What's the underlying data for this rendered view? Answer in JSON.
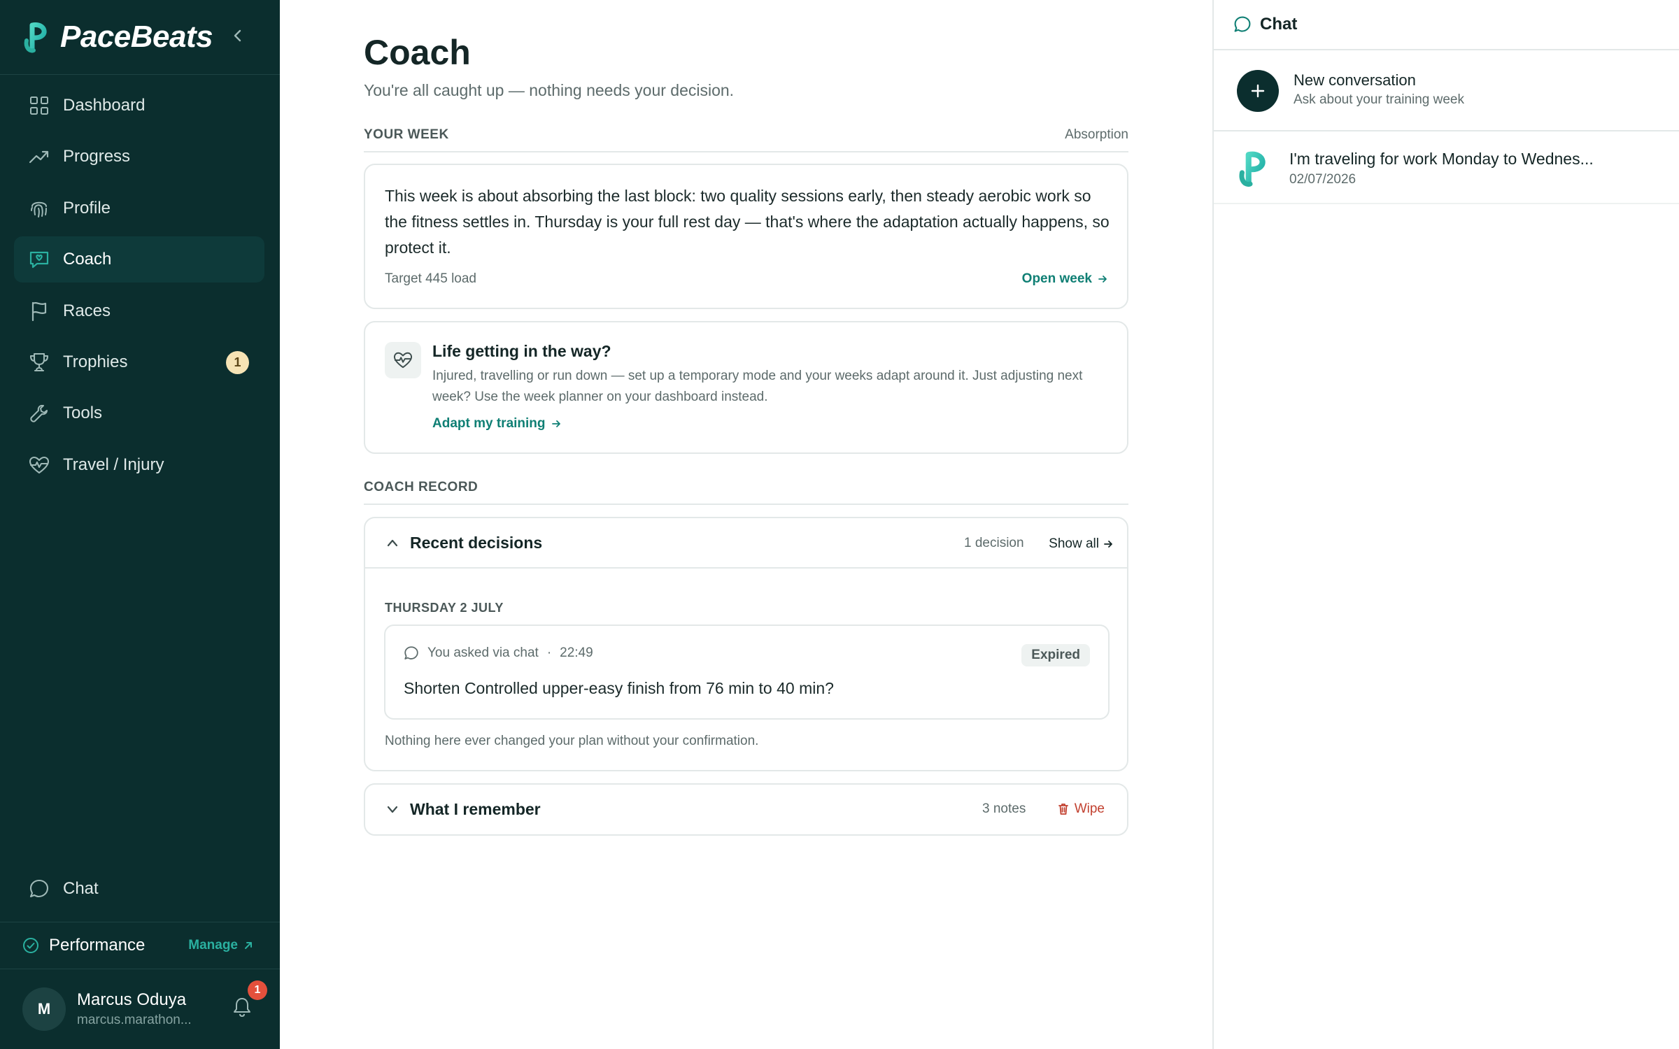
{
  "app": {
    "name": "PaceBeats"
  },
  "sidebar": {
    "items": [
      {
        "label": "Dashboard",
        "icon": "dashboard-icon"
      },
      {
        "label": "Progress",
        "icon": "trending-up-icon"
      },
      {
        "label": "Profile",
        "icon": "fingerprint-icon"
      },
      {
        "label": "Coach",
        "icon": "coach-message-icon",
        "active": true
      },
      {
        "label": "Races",
        "icon": "flag-icon"
      },
      {
        "label": "Trophies",
        "icon": "trophy-icon",
        "badge": "1"
      },
      {
        "label": "Tools",
        "icon": "wrench-icon"
      },
      {
        "label": "Travel / Injury",
        "icon": "heart-pulse-icon"
      }
    ],
    "chat_label": "Chat",
    "plan": {
      "label": "Performance",
      "manage_label": "Manage"
    },
    "user": {
      "initial": "M",
      "name": "Marcus Oduya",
      "email": "marcus.marathon...",
      "notification_count": "1"
    }
  },
  "main": {
    "title": "Coach",
    "subtitle": "You're all caught up — nothing needs your decision.",
    "your_week": {
      "label": "YOUR WEEK",
      "phase": "Absorption",
      "text": "This week is about absorbing the last block: two quality sessions early, then steady aerobic work so the fitness settles in. Thursday is your full rest day — that's where the adaptation actually happens, so protect it.",
      "target": "Target 445 load",
      "open_link": "Open week"
    },
    "life": {
      "title": "Life getting in the way?",
      "text": "Injured, travelling or run down — set up a temporary mode and your weeks adapt around it. Just adjusting next week? Use the week planner on your dashboard instead.",
      "link": "Adapt my training"
    },
    "coach_record": {
      "label": "COACH RECORD",
      "recent": {
        "title": "Recent decisions",
        "count": "1 decision",
        "show_all": "Show all",
        "date": "THURSDAY 2 JULY",
        "decision": {
          "source": "You asked via chat",
          "separator": "·",
          "time": "22:49",
          "status": "Expired",
          "text": "Shorten Controlled upper-easy finish from 76 min to 40 min?"
        },
        "footer": "Nothing here ever changed your plan without your confirmation."
      },
      "remember": {
        "title": "What I remember",
        "count": "3 notes",
        "wipe": "Wipe"
      }
    }
  },
  "chat_panel": {
    "title": "Chat",
    "new_conversation": {
      "title": "New conversation",
      "subtitle": "Ask about your training week"
    },
    "conversations": [
      {
        "title": "I'm traveling for work Monday to Wednes...",
        "date": "02/07/2026"
      }
    ]
  },
  "colors": {
    "sidebar_bg": "#0b2e2e",
    "accent": "#0f7f74",
    "brand_teal": "#2ab0a0",
    "danger": "#c24130",
    "badge_bg": "#f6e3b5"
  }
}
